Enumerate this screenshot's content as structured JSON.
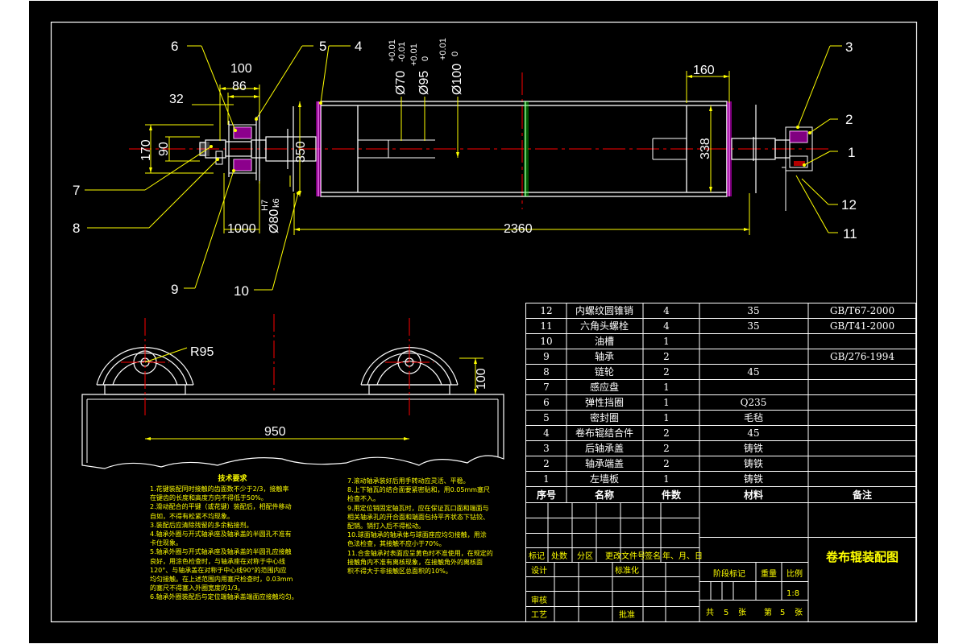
{
  "balloons": {
    "n1": "1",
    "n2": "2",
    "n3": "3",
    "n4": "4",
    "n5": "5",
    "n6": "6",
    "n7": "7",
    "n8": "8",
    "n9": "9",
    "n10": "10",
    "n11": "11",
    "n12": "12"
  },
  "dims": {
    "d100": "100",
    "d86": "86",
    "d32": "32",
    "d170": "170",
    "d90": "90",
    "d350": "350",
    "d1000": "1000",
    "d80_main": "Ø80",
    "d80_fit_top": "H7",
    "d80_fit_bot": "k6",
    "d70_main": "Ø70",
    "d70_tol_up": "+0.01",
    "d70_tol_lo": "-0.01",
    "d95_main": "Ø95",
    "d95_tol_up": "+0.01",
    "d95_tol_lo": "0",
    "d100b_main": "Ø100",
    "d100b_tol_up": "+0.01",
    "d100b_tol_lo": "0",
    "d160": "160",
    "d338": "338",
    "d2360": "2360",
    "r95": "R95",
    "d100_side": "100",
    "d950": "950"
  },
  "parts_table": {
    "rows": [
      {
        "no": "12",
        "name": "内螺纹圆锥销",
        "qty": "4",
        "material": "35",
        "note": "GB/T67-2000"
      },
      {
        "no": "11",
        "name": "六角头螺栓",
        "qty": "4",
        "material": "35",
        "note": "GB/T41-2000"
      },
      {
        "no": "10",
        "name": "油槽",
        "qty": "1",
        "material": "",
        "note": ""
      },
      {
        "no": "9",
        "name": "轴承",
        "qty": "2",
        "material": "",
        "note": "GB/276-1994"
      },
      {
        "no": "8",
        "name": "链轮",
        "qty": "2",
        "material": "45",
        "note": ""
      },
      {
        "no": "7",
        "name": "感应盘",
        "qty": "1",
        "material": "",
        "note": ""
      },
      {
        "no": "6",
        "name": "弹性挡圈",
        "qty": "1",
        "material": "Q235",
        "note": ""
      },
      {
        "no": "5",
        "name": "密封圈",
        "qty": "1",
        "material": "毛毡",
        "note": ""
      },
      {
        "no": "4",
        "name": "卷布辊结合件",
        "qty": "2",
        "material": "45",
        "note": ""
      },
      {
        "no": "3",
        "name": "后轴承盖",
        "qty": "2",
        "material": "铸铁",
        "note": ""
      },
      {
        "no": "2",
        "name": "轴承端盖",
        "qty": "2",
        "material": "铸铁",
        "note": ""
      },
      {
        "no": "1",
        "name": "左墙板",
        "qty": "1",
        "material": "铸铁",
        "note": ""
      }
    ],
    "header": {
      "no": "序号",
      "name": "名称",
      "qty": "件数",
      "material": "材料",
      "note": "备注"
    }
  },
  "title_block": {
    "drawing_title": "卷布辊装配图",
    "rev_labels": [
      "标记",
      "处数",
      "分区",
      "更改文件号",
      "签名",
      "年、月、日"
    ],
    "design": "设计",
    "standardize": "标准化",
    "stage_mark": "阶段标记",
    "weight": "重量",
    "scale": "比例",
    "scale_value": "1:8",
    "review": "审核",
    "process": "工艺",
    "approve": "批准",
    "total": "共",
    "total_n": "5",
    "sheets1": "张",
    "page": "第",
    "page_n": "5",
    "sheets2": "张"
  },
  "tech_notes": {
    "title": "技术要求",
    "left": [
      "1.花键装配同时接触的齿面数不少于2/3，接触率",
      "在键齿的长度和高度方向不得低于50%。",
      "2.滑动配合的平键（或花键）装配后，相配件移动",
      "自如，不得有松紧不均现象。",
      "3.装配后应清除残留的多余粘接剂。",
      "4.轴承外圈与开式轴承座及轴承盖的半圆孔不准有",
      "卡住现象。",
      "5.轴承外圈与开式轴承座及轴承盖的半圆孔应接触",
      "良好，用涂色检查时，与轴承座在对称于中心线",
      "120°、与轴承盖在对称于中心线90°的范围内应",
      "均匀接触。在上述范围内用塞尺检查时，0.03mm",
      "的塞尺不得塞入外圈宽度的1/3。",
      "6.轴承外圈装配后与定位端轴承盖端面应接触均匀。"
    ],
    "right": [
      "7.滚动轴承装好后用手转动应灵活、平稳。",
      "8.上下轴瓦的结合面要紧密贴和，用0.05mm塞尺",
      "检查不入。",
      "9.用定位销固定轴瓦时，应在保证瓦口面和端面与",
      "相关轴承孔的开合面和端面包持平齐状态下钻铰、",
      "配销。销打入后不得松动。",
      "10.球面轴承的轴承体与球面座应均匀接触，用涂",
      "色法检查，其接触不应小于70%。",
      "11.合金轴承衬表面应呈黄色时不准使用，在规定的",
      "接触角内不准有离核现象，在接触角外的离核面",
      "积不得大于非接触区总面积的10%。"
    ]
  }
}
